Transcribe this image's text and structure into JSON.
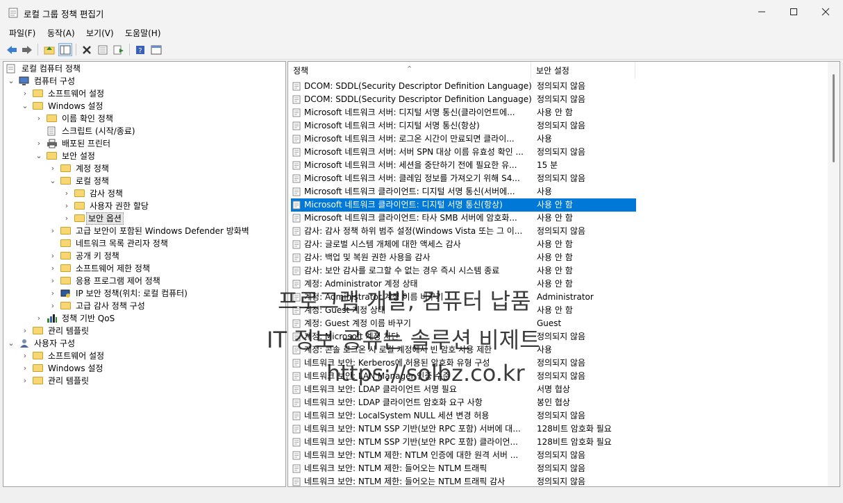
{
  "window": {
    "title": "로컬 그룹 정책 편집기"
  },
  "menu": [
    "파일(F)",
    "동작(A)",
    "보기(V)",
    "도움말(H)"
  ],
  "tree": {
    "root": "로컬 컴퓨터 정책",
    "computer_config": "컴퓨터 구성",
    "software_settings": "소프트웨어 설정",
    "windows_settings": "Windows 설정",
    "name_resolution_policy": "이름 확인 정책",
    "scripts": "스크립트 (시작/종료)",
    "deployed_printers": "배포된 프린터",
    "security_settings": "보안 설정",
    "account_policy": "계정 정책",
    "local_policy": "로컬 정책",
    "audit_policy": "감사 정책",
    "user_rights": "사용자 권한 할당",
    "security_options": "보안 옵션",
    "defender_firewall": "고급 보안이 포함된 Windows Defender 방화벽",
    "network_list_manager": "네트워크 목록 관리자 정책",
    "public_key_policy": "공개 키 정책",
    "software_restriction": "소프트웨어 제한 정책",
    "app_control": "응용 프로그램 제어 정책",
    "ipsec_policy": "IP 보안 정책(위치: 로컬 컴퓨터)",
    "advanced_audit": "고급 감사 정책 구성",
    "qos_policy": "정책 기반 QoS",
    "admin_templates": "관리 템플릿",
    "user_config": "사용자 구성",
    "user_software_settings": "소프트웨어 설정",
    "user_windows_settings": "Windows 설정",
    "user_admin_templates": "관리 템플릿"
  },
  "list": {
    "col_policy": "정책",
    "col_setting": "보안 설정",
    "rows": [
      {
        "policy": "DCOM: SDDL(Security Descriptor Definition Language) 구...",
        "setting": "정의되지 않음"
      },
      {
        "policy": "DCOM: SDDL(Security Descriptor Definition Language) 구...",
        "setting": "정의되지 않음"
      },
      {
        "policy": "Microsoft 네트워크 서버: 디지털 서명 통신(클라이언트에...",
        "setting": "사용 안 함"
      },
      {
        "policy": "Microsoft 네트워크 서버: 디지털 서명 통신(항상)",
        "setting": "정의되지 않음"
      },
      {
        "policy": "Microsoft 네트워크 서버: 로그온 시간이 만료되면 클라이...",
        "setting": "사용"
      },
      {
        "policy": "Microsoft 네트워크 서버: 서버 SPN 대상 이름 유효성 확인 ...",
        "setting": "정의되지 않음"
      },
      {
        "policy": "Microsoft 네트워크 서버: 세션을 중단하기 전에 필요한 유...",
        "setting": "15 분"
      },
      {
        "policy": "Microsoft 네트워크 서버: 클레임 정보를 가져오기 위해 S4...",
        "setting": "정의되지 않음"
      },
      {
        "policy": "Microsoft 네트워크 클라이언트: 디지털 서명 통신(서버에...",
        "setting": "사용"
      },
      {
        "policy": "Microsoft 네트워크 클라이언트: 디지털 서명 통신(항상)",
        "setting": "사용 안 함"
      },
      {
        "policy": "Microsoft 네트워크 클라이언트: 타사 SMB 서버에 암호화...",
        "setting": "사용 안 함"
      },
      {
        "policy": "감사: 감사 정책 하위 범주 설정(Windows Vista 또는 그 이...",
        "setting": "정의되지 않음"
      },
      {
        "policy": "감사: 글로벌 시스템 개체에 대한 액세스 감사",
        "setting": "사용 안 함"
      },
      {
        "policy": "감사: 백업 및 복원 권한 사용을 감사",
        "setting": "사용 안 함"
      },
      {
        "policy": "감사: 보안 감사를 로그할 수 없는 경우 즉시 시스템 종료",
        "setting": "사용 안 함"
      },
      {
        "policy": "계정: Administrator 계정 상태",
        "setting": "사용 안 함"
      },
      {
        "policy": "계정: Administrator 계정 이름 바꾸기",
        "setting": "Administrator"
      },
      {
        "policy": "계정: Guest 계정 상태",
        "setting": "사용 안 함"
      },
      {
        "policy": "계정: Guest 계정 이름 바꾸기",
        "setting": "Guest"
      },
      {
        "policy": "계정: Microsoft 계정 차단",
        "setting": "정의되지 않음"
      },
      {
        "policy": "계정: 콘솔 로그온 시 로컬 계정에서 빈 암호 사용 제한",
        "setting": "사용"
      },
      {
        "policy": "네트워크 보안: Kerberos에 허용된 암호화 유형 구성",
        "setting": "정의되지 않음"
      },
      {
        "policy": "네트워크 보안: LAN Manager 인증 수준",
        "setting": "정의되지 않음"
      },
      {
        "policy": "네트워크 보안: LDAP 클라이언트 서명 필요",
        "setting": "서명 협상"
      },
      {
        "policy": "네트워크 보안: LDAP 클라이언트 암호화 요구 사항",
        "setting": "봉인 협상"
      },
      {
        "policy": "네트워크 보안: LocalSystem NULL 세션 변경 허용",
        "setting": "정의되지 않음"
      },
      {
        "policy": "네트워크 보안: NTLM SSP 기반(보안 RPC 포함) 서버에 대...",
        "setting": "128비트 암호화 필요"
      },
      {
        "policy": "네트워크 보안: NTLM SSP 기반(보안 RPC 포함) 클라이언...",
        "setting": "128비트 암호화 필요"
      },
      {
        "policy": "네트워크 보안: NTLM 제한: NTLM 인증에 대한 원격 서버 ...",
        "setting": "정의되지 않음"
      },
      {
        "policy": "네트워크 보안: NTLM 제한: 들어오는 NTLM 트래픽",
        "setting": "정의되지 않음"
      },
      {
        "policy": "네트워크 보안: NTLM 제한: 들어오는 NTLM 트래픽 감사",
        "setting": "정의되지 않음"
      }
    ]
  },
  "watermark": {
    "line1": "프로그램 개발, 컴퓨터 납품",
    "line2": "IT 정보 공유는 솔루션 비제트",
    "line3": "https://solbz.co.kr"
  },
  "colors": {
    "selection": "#0078d7",
    "folder": "#f7d774"
  }
}
